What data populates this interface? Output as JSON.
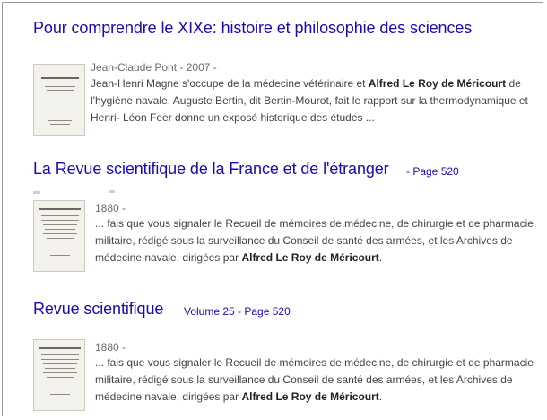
{
  "results": [
    {
      "title": "Pour comprendre le XIXe: histoire et philosophie des sciences",
      "meta": "Jean-Claude Pont - 2007 -",
      "snippet_lines": [
        [
          "Jean-Henri Magne s'occupe de la médecine vétérinaire et ",
          "Alfred Le Roy de Méricourt",
          " de"
        ],
        [
          "l'hygiène navale. Auguste Bertin, dit Bertin-Mourot, fait le rapport sur la thermodynamique et",
          "",
          ""
        ],
        [
          "Henri- Léon Feer donne un exposé historique des études ...",
          "",
          ""
        ]
      ]
    },
    {
      "title": "La Revue scientifique de la France et de l'étranger",
      "page": "- Page 520",
      "meta": "1880 -",
      "snippet_lines": [
        [
          "... fais que vous signaler le Recueil de mémoires de médecine, de chirurgie et de pharmacie",
          "",
          ""
        ],
        [
          "militaire, rédigé sous la surveillance du Conseil de santé des armées, et les Archives de",
          "",
          ""
        ],
        [
          "médecine navale, dirigées par ",
          "Alfred Le Roy de Méricourt",
          "."
        ]
      ]
    },
    {
      "title": "Revue scientifique",
      "page": "Volume 25 - Page 520",
      "meta": "1880 -",
      "snippet_lines": [
        [
          "... fais que vous signaler le Recueil de mémoires de médecine, de chirurgie et de pharmacie",
          "",
          ""
        ],
        [
          "militaire, rédigé sous la surveillance du Conseil de santé des armées, et les Archives de",
          "",
          ""
        ],
        [
          "médecine navale, dirigées par ",
          "Alfred Le Roy de Méricourt",
          "."
        ]
      ]
    }
  ]
}
